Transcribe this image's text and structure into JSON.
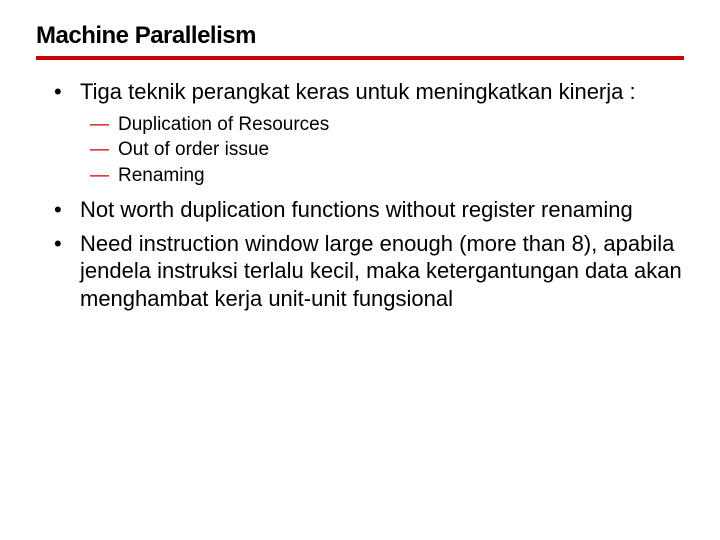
{
  "slide": {
    "title": "Machine Parallelism",
    "bullets": [
      {
        "text": "Tiga teknik perangkat keras untuk meningkatkan kinerja :",
        "subs": [
          "Duplication of Resources",
          "Out of order issue",
          "Renaming"
        ]
      },
      {
        "text": "Not worth duplication functions without register renaming",
        "subs": []
      },
      {
        "text": "Need instruction window large enough (more than 8), apabila jendela instruksi terlalu kecil, maka ketergantungan data akan menghambat kerja unit-unit fungsional",
        "subs": []
      }
    ]
  }
}
